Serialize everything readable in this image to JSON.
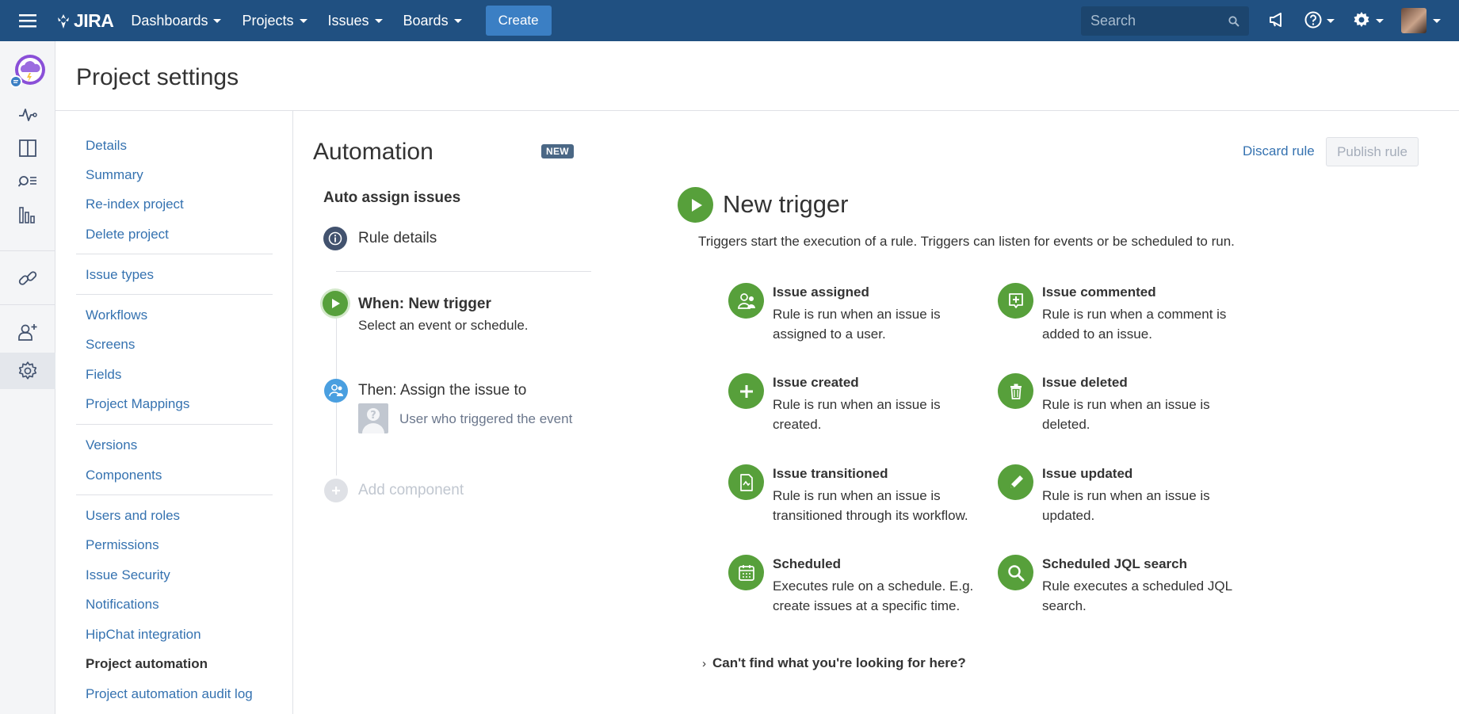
{
  "topnav": {
    "logo": "JIRA",
    "menus": [
      "Dashboards",
      "Projects",
      "Issues",
      "Boards"
    ],
    "create_label": "Create",
    "search_placeholder": "Search"
  },
  "header": {
    "title": "Project settings"
  },
  "settings_nav": {
    "groups": [
      [
        "Details",
        "Summary",
        "Re-index project",
        "Delete project"
      ],
      [
        "Issue types"
      ],
      [
        "Workflows",
        "Screens",
        "Fields",
        "Project Mappings"
      ],
      [
        "Versions",
        "Components"
      ],
      [
        "Users and roles",
        "Permissions",
        "Issue Security",
        "Notifications",
        "HipChat integration",
        "Project automation",
        "Project automation audit log"
      ]
    ],
    "active": "Project automation"
  },
  "automation": {
    "title": "Automation",
    "badge": "NEW",
    "rule_name": "Auto assign issues",
    "rule_details": "Rule details",
    "when_title": "When: New trigger",
    "when_sub": "Select an event or schedule.",
    "then_title": "Then: Assign the issue to",
    "then_sub": "User who triggered the event",
    "add_component": "Add component"
  },
  "actions": {
    "discard": "Discard rule",
    "publish": "Publish rule"
  },
  "trigger": {
    "title": "New trigger",
    "description": "Triggers start the execution of a rule. Triggers can listen for events or be scheduled to run.",
    "options": [
      {
        "title": "Issue assigned",
        "desc": "Rule is run when an issue is assigned to a user.",
        "icon": "user-assign-icon"
      },
      {
        "title": "Issue commented",
        "desc": "Rule is run when a comment is added to an issue.",
        "icon": "comment-icon"
      },
      {
        "title": "Issue created",
        "desc": "Rule is run when an issue is created.",
        "icon": "plus-icon"
      },
      {
        "title": "Issue deleted",
        "desc": "Rule is run when an issue is deleted.",
        "icon": "trash-icon"
      },
      {
        "title": "Issue transitioned",
        "desc": "Rule is run when an issue is transitioned through its workflow.",
        "icon": "transition-icon"
      },
      {
        "title": "Issue updated",
        "desc": "Rule is run when an issue is updated.",
        "icon": "pencil-icon"
      },
      {
        "title": "Scheduled",
        "desc": "Executes rule on a schedule. E.g. create issues at a specific time.",
        "icon": "calendar-icon"
      },
      {
        "title": "Scheduled JQL search",
        "desc": "Rule executes a scheduled JQL search.",
        "icon": "search-icon"
      }
    ],
    "cant_find": "Can't find what you're looking for here?"
  },
  "colors": {
    "nav": "#205081",
    "link": "#3572b0",
    "trigger_green": "#57a03b"
  }
}
